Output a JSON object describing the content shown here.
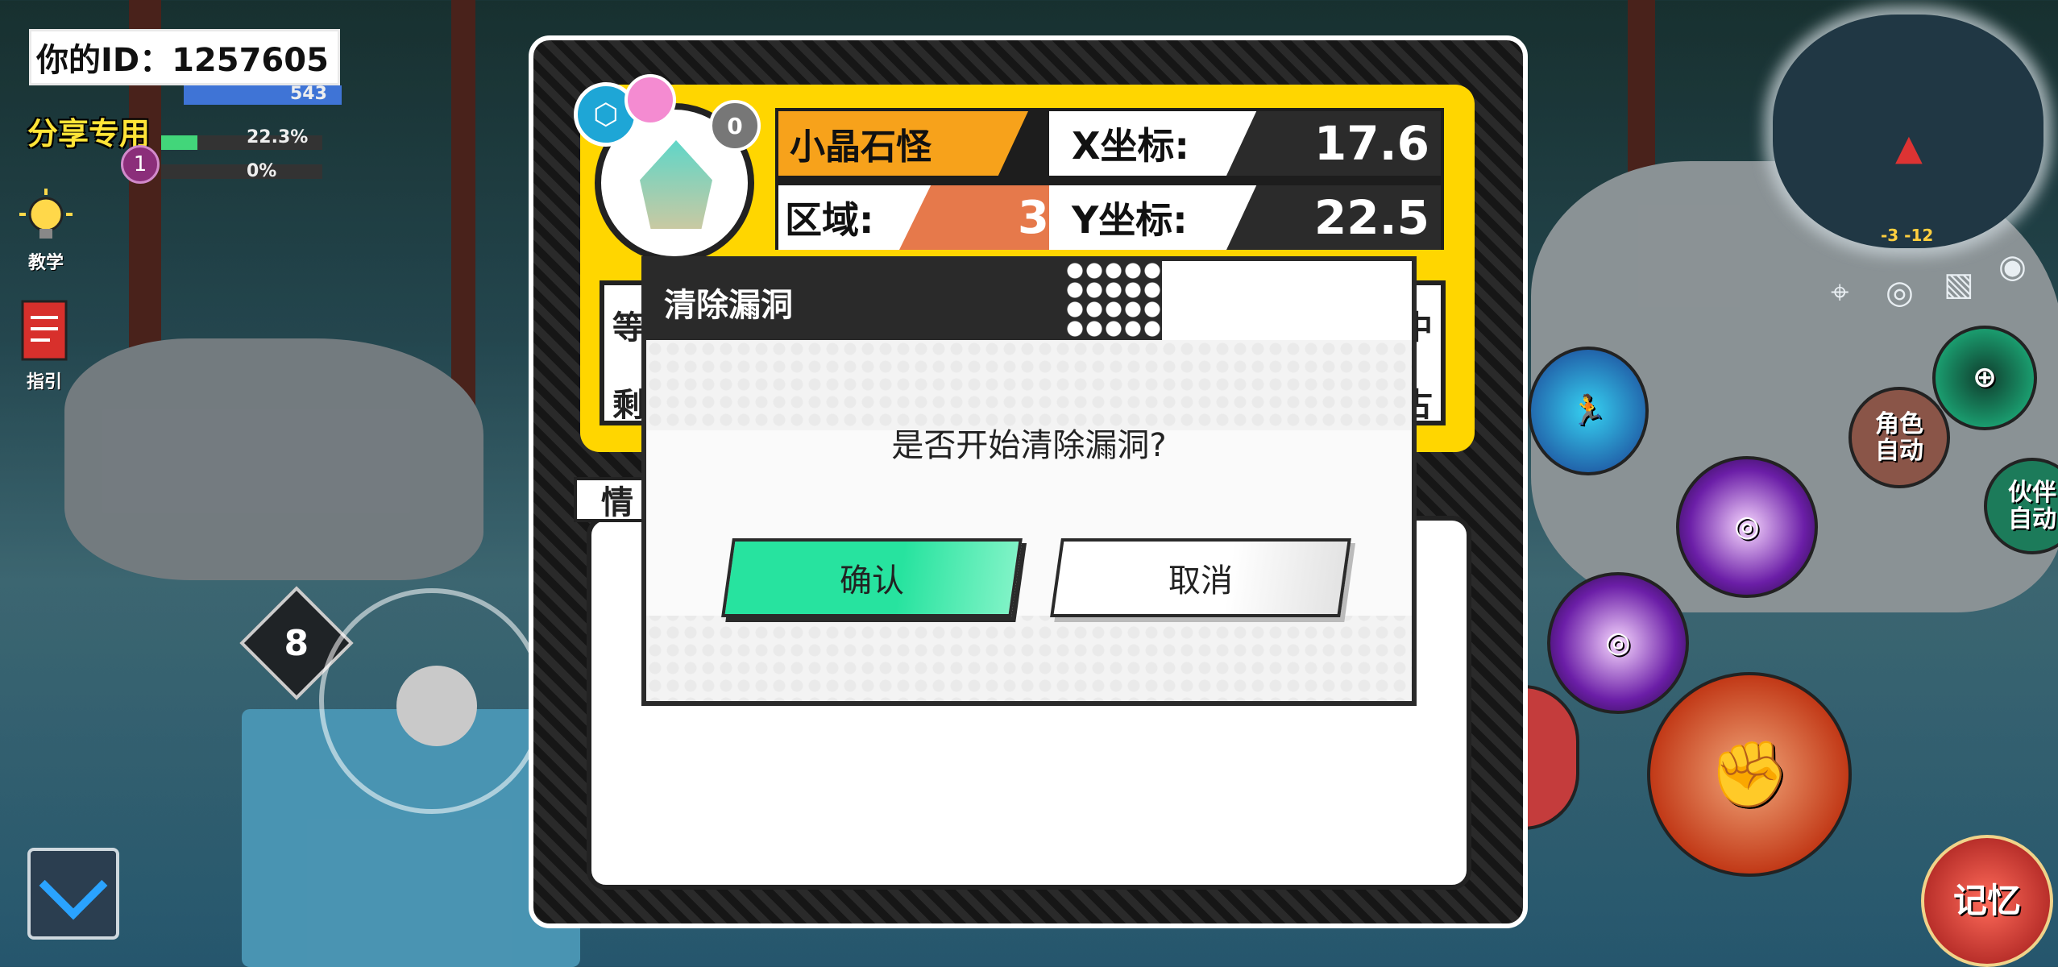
{
  "hud": {
    "player_id_text": "你的ID：1257605",
    "share_label": "分享专用",
    "hp_text": "543",
    "exp_percent_text": "22.3%",
    "exp_fill": 0.223,
    "mana_percent_text": "0%",
    "mana_fill": 0,
    "level_badge": "1",
    "tutorial_label": "教学",
    "guide_label": "指引",
    "joystick_level": "8"
  },
  "monster_card": {
    "name": "小晶石怪",
    "x_label": "X坐标:",
    "x_value": "17.6",
    "area_label": "区域:",
    "area_value": "3",
    "y_label": "Y坐标:",
    "y_value": "22.5",
    "level_badge": "0",
    "stat_left_1": "等",
    "stat_left_2": "剩",
    "stat_right_1": "中",
    "stat_right_2": "古",
    "info_tab": "情"
  },
  "dialog": {
    "title": "清除漏洞",
    "message": "是否开始清除漏洞?",
    "confirm_label": "确认",
    "cancel_label": "取消"
  },
  "right_hud": {
    "minimap_coords": "-3 -12",
    "role_auto_label": "角色自动",
    "partner_auto_label": "伙伴自动",
    "memory_label": "记忆"
  },
  "colors": {
    "accent_yellow": "#ffd600",
    "confirm_green": "#27e39f",
    "name_orange": "#f7a21b",
    "area_orange": "#e6794b"
  }
}
